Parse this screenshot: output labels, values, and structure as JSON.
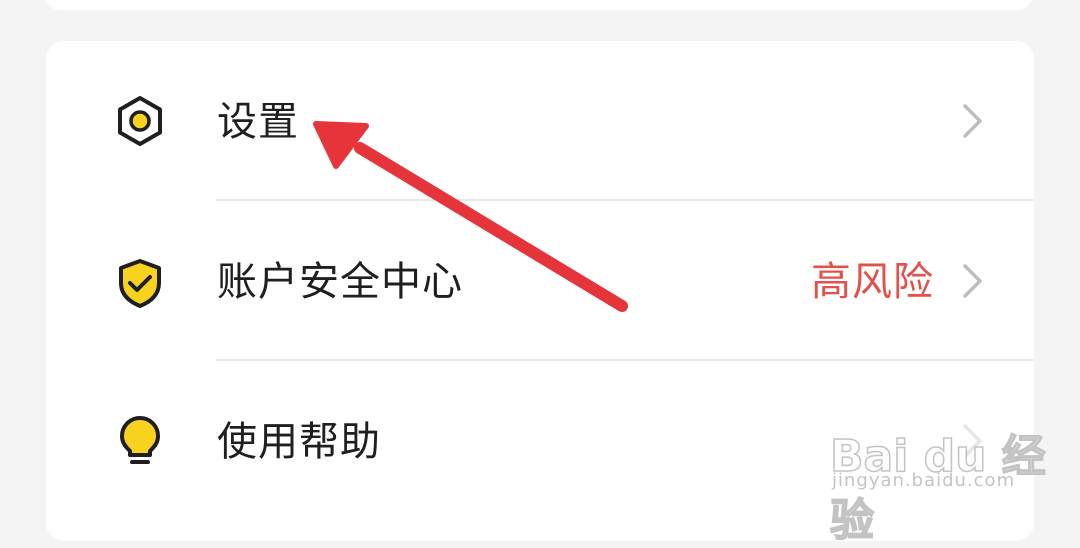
{
  "menu": {
    "items": [
      {
        "label": "设置",
        "icon": "gear-hexagon-icon",
        "status": ""
      },
      {
        "label": "账户安全中心",
        "icon": "shield-check-icon",
        "status": "高风险"
      },
      {
        "label": "使用帮助",
        "icon": "lightbulb-icon",
        "status": ""
      }
    ]
  },
  "watermark": {
    "brand": "Bai du 经验",
    "url": "jingyan.baidu.com"
  },
  "colors": {
    "accent_yellow": "#f7d21e",
    "warning_red": "#e2514a",
    "arrow_red": "#e5343a"
  }
}
